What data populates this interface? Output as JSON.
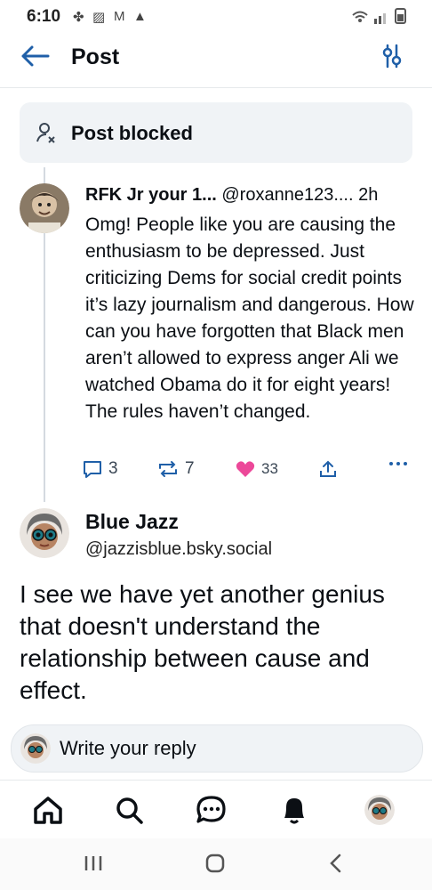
{
  "status_bar": {
    "time": "6:10"
  },
  "header": {
    "title": "Post"
  },
  "blocked": {
    "label": "Post blocked"
  },
  "reply_post": {
    "display_name": "RFK Jr your 1...",
    "handle": "@roxanne123....",
    "age": "2h",
    "text": "Omg! People like you are causing the enthusiasm to be depressed. Just criticizing Dems for social credit points it’s lazy journalism and dangerous.  How can you have forgotten that Black men aren’t allowed to express anger Ali we watched Obama do it for eight years!  The rules haven’t changed.",
    "reply_count": "3",
    "repost_count": "7",
    "like_count": "33",
    "like_color": "#ec4899"
  },
  "main_post": {
    "display_name": "Blue Jazz",
    "handle": "@jazzisblue.bsky.social",
    "text": "I see we have yet another genius that doesn't understand the relationship between cause and effect."
  },
  "composer": {
    "placeholder": "Write your reply"
  },
  "colors": {
    "accent": "#1f5fa8",
    "muted_bg": "#f0f3f6"
  },
  "tabs": [
    "home-icon",
    "search-icon",
    "chat-icon",
    "notifications-icon",
    "profile-avatar"
  ]
}
